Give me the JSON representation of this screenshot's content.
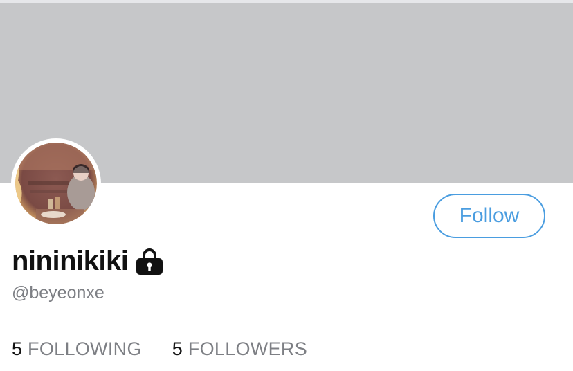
{
  "profile": {
    "display_name": "nininikiki",
    "handle": "@beyeonxe",
    "protected_icon": "lock-icon"
  },
  "actions": {
    "follow_label": "Follow"
  },
  "stats": {
    "following_count": "5",
    "following_label": "FOLLOWING",
    "followers_count": "5",
    "followers_label": "FOLLOWERS"
  },
  "colors": {
    "banner": "#c6c7c9",
    "accent": "#4a9de0",
    "secondary_text": "#7d7f84"
  }
}
